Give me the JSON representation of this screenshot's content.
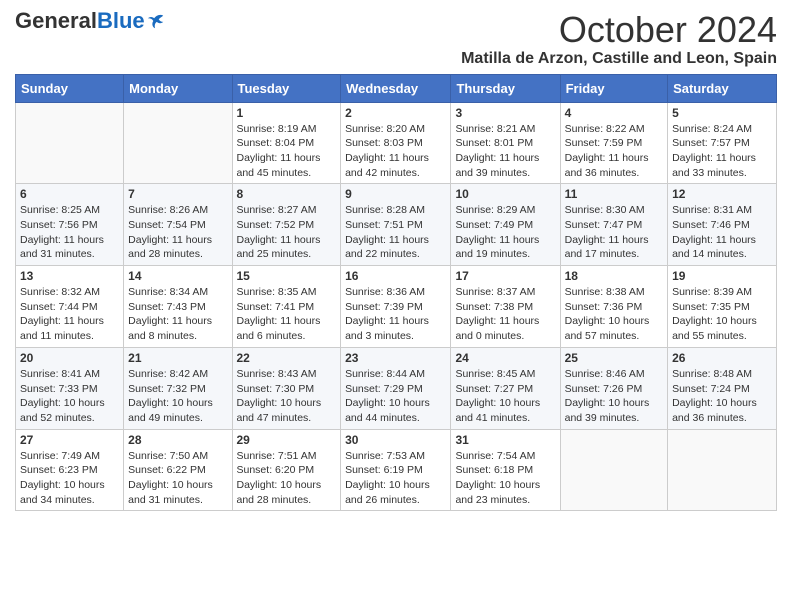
{
  "header": {
    "logo": {
      "general": "General",
      "blue": "Blue"
    },
    "title": "October 2024",
    "location": "Matilla de Arzon, Castille and Leon, Spain"
  },
  "calendar": {
    "days_of_week": [
      "Sunday",
      "Monday",
      "Tuesday",
      "Wednesday",
      "Thursday",
      "Friday",
      "Saturday"
    ],
    "weeks": [
      [
        {
          "day": "",
          "info": ""
        },
        {
          "day": "",
          "info": ""
        },
        {
          "day": "1",
          "info": "Sunrise: 8:19 AM\nSunset: 8:04 PM\nDaylight: 11 hours and 45 minutes."
        },
        {
          "day": "2",
          "info": "Sunrise: 8:20 AM\nSunset: 8:03 PM\nDaylight: 11 hours and 42 minutes."
        },
        {
          "day": "3",
          "info": "Sunrise: 8:21 AM\nSunset: 8:01 PM\nDaylight: 11 hours and 39 minutes."
        },
        {
          "day": "4",
          "info": "Sunrise: 8:22 AM\nSunset: 7:59 PM\nDaylight: 11 hours and 36 minutes."
        },
        {
          "day": "5",
          "info": "Sunrise: 8:24 AM\nSunset: 7:57 PM\nDaylight: 11 hours and 33 minutes."
        }
      ],
      [
        {
          "day": "6",
          "info": "Sunrise: 8:25 AM\nSunset: 7:56 PM\nDaylight: 11 hours and 31 minutes."
        },
        {
          "day": "7",
          "info": "Sunrise: 8:26 AM\nSunset: 7:54 PM\nDaylight: 11 hours and 28 minutes."
        },
        {
          "day": "8",
          "info": "Sunrise: 8:27 AM\nSunset: 7:52 PM\nDaylight: 11 hours and 25 minutes."
        },
        {
          "day": "9",
          "info": "Sunrise: 8:28 AM\nSunset: 7:51 PM\nDaylight: 11 hours and 22 minutes."
        },
        {
          "day": "10",
          "info": "Sunrise: 8:29 AM\nSunset: 7:49 PM\nDaylight: 11 hours and 19 minutes."
        },
        {
          "day": "11",
          "info": "Sunrise: 8:30 AM\nSunset: 7:47 PM\nDaylight: 11 hours and 17 minutes."
        },
        {
          "day": "12",
          "info": "Sunrise: 8:31 AM\nSunset: 7:46 PM\nDaylight: 11 hours and 14 minutes."
        }
      ],
      [
        {
          "day": "13",
          "info": "Sunrise: 8:32 AM\nSunset: 7:44 PM\nDaylight: 11 hours and 11 minutes."
        },
        {
          "day": "14",
          "info": "Sunrise: 8:34 AM\nSunset: 7:43 PM\nDaylight: 11 hours and 8 minutes."
        },
        {
          "day": "15",
          "info": "Sunrise: 8:35 AM\nSunset: 7:41 PM\nDaylight: 11 hours and 6 minutes."
        },
        {
          "day": "16",
          "info": "Sunrise: 8:36 AM\nSunset: 7:39 PM\nDaylight: 11 hours and 3 minutes."
        },
        {
          "day": "17",
          "info": "Sunrise: 8:37 AM\nSunset: 7:38 PM\nDaylight: 11 hours and 0 minutes."
        },
        {
          "day": "18",
          "info": "Sunrise: 8:38 AM\nSunset: 7:36 PM\nDaylight: 10 hours and 57 minutes."
        },
        {
          "day": "19",
          "info": "Sunrise: 8:39 AM\nSunset: 7:35 PM\nDaylight: 10 hours and 55 minutes."
        }
      ],
      [
        {
          "day": "20",
          "info": "Sunrise: 8:41 AM\nSunset: 7:33 PM\nDaylight: 10 hours and 52 minutes."
        },
        {
          "day": "21",
          "info": "Sunrise: 8:42 AM\nSunset: 7:32 PM\nDaylight: 10 hours and 49 minutes."
        },
        {
          "day": "22",
          "info": "Sunrise: 8:43 AM\nSunset: 7:30 PM\nDaylight: 10 hours and 47 minutes."
        },
        {
          "day": "23",
          "info": "Sunrise: 8:44 AM\nSunset: 7:29 PM\nDaylight: 10 hours and 44 minutes."
        },
        {
          "day": "24",
          "info": "Sunrise: 8:45 AM\nSunset: 7:27 PM\nDaylight: 10 hours and 41 minutes."
        },
        {
          "day": "25",
          "info": "Sunrise: 8:46 AM\nSunset: 7:26 PM\nDaylight: 10 hours and 39 minutes."
        },
        {
          "day": "26",
          "info": "Sunrise: 8:48 AM\nSunset: 7:24 PM\nDaylight: 10 hours and 36 minutes."
        }
      ],
      [
        {
          "day": "27",
          "info": "Sunrise: 7:49 AM\nSunset: 6:23 PM\nDaylight: 10 hours and 34 minutes."
        },
        {
          "day": "28",
          "info": "Sunrise: 7:50 AM\nSunset: 6:22 PM\nDaylight: 10 hours and 31 minutes."
        },
        {
          "day": "29",
          "info": "Sunrise: 7:51 AM\nSunset: 6:20 PM\nDaylight: 10 hours and 28 minutes."
        },
        {
          "day": "30",
          "info": "Sunrise: 7:53 AM\nSunset: 6:19 PM\nDaylight: 10 hours and 26 minutes."
        },
        {
          "day": "31",
          "info": "Sunrise: 7:54 AM\nSunset: 6:18 PM\nDaylight: 10 hours and 23 minutes."
        },
        {
          "day": "",
          "info": ""
        },
        {
          "day": "",
          "info": ""
        }
      ]
    ]
  }
}
